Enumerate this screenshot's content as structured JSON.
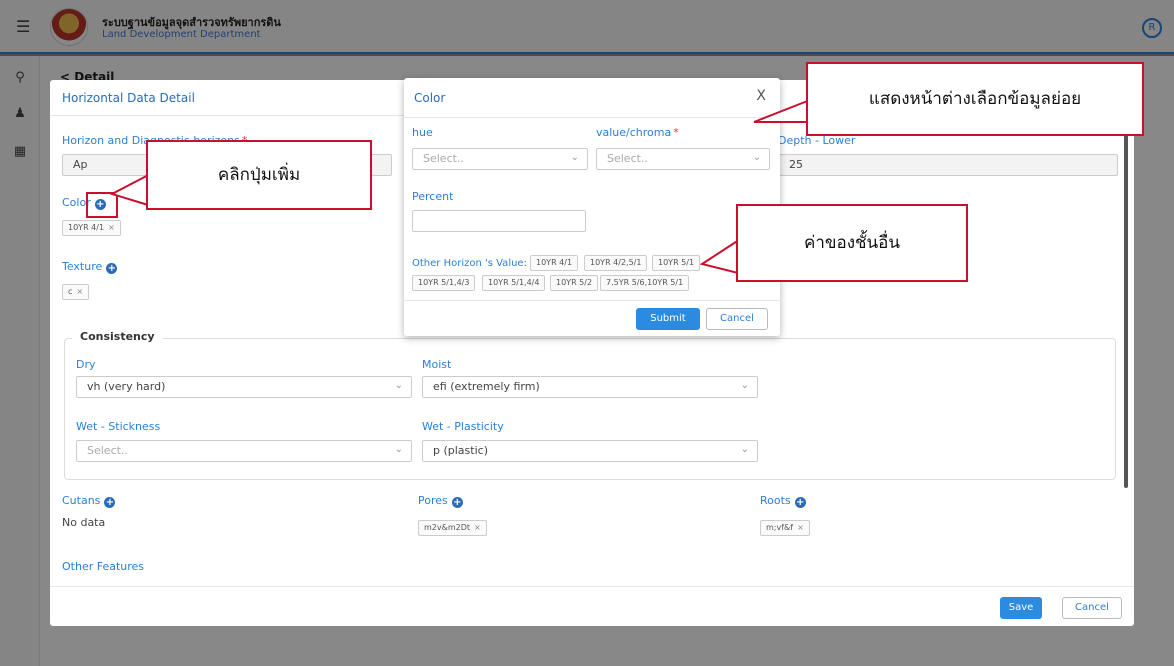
{
  "app": {
    "title": "ระบบฐานข้อมูลจุดสำรวจทรัพยากรดิน",
    "subtitle": "Land Development Department",
    "breadcrumb": "< Detail"
  },
  "detail": {
    "title": "Horizontal Data Detail",
    "horizon_label": "Horizon and Diagnostic horizons",
    "horizon_value": "Ap",
    "depth_lower_label": "Depth - Lower",
    "depth_lower_value": "25",
    "color_label": "Color",
    "color_tag": "10YR 4/1",
    "texture_label": "Texture",
    "texture_tag": "c",
    "consistency": {
      "legend": "Consistency",
      "dry_label": "Dry",
      "dry_value": "vh (very hard)",
      "moist_label": "Moist",
      "moist_value": "efi (extremely firm)",
      "wet_stick_label": "Wet - Stickness",
      "wet_stick_placeholder": "Select..",
      "wet_plast_label": "Wet - Plasticity",
      "wet_plast_value": "p (plastic)"
    },
    "cutans_label": "Cutans",
    "cutans_value": "No data",
    "pores_label": "Pores",
    "pores_tag": "m2v&m2Dt",
    "roots_label": "Roots",
    "roots_tag": "m;vf&f",
    "other_features_label": "Other Features",
    "save_label": "Save",
    "cancel_label": "Cancel",
    "tag_remove": "×"
  },
  "color_modal": {
    "title": "Color",
    "close": "X",
    "hue_label": "hue",
    "hue_placeholder": "Select..",
    "vc_label": "value/chroma",
    "vc_placeholder": "Select..",
    "percent_label": "Percent",
    "percent_value": "",
    "other_label": "Other Horizon 's Value:",
    "other_values": [
      "10YR 4/1",
      "10YR 4/2,5/1",
      "10YR 5/1",
      "10YR 5/1,4/3",
      "10YR 5/1,4/4",
      "10YR 5/2",
      "7.5YR 5/6,10YR 5/1"
    ],
    "submit_label": "Submit",
    "cancel_label": "Cancel"
  },
  "callouts": {
    "click_add": "คลิกปุ่มเพิ่ม",
    "show_window": "แสดงหน้าต่างเลือกข้อมูลย่อย",
    "other_values": "ค่าของชั้นอื่น"
  },
  "colors": {
    "primary": "#2b8be0",
    "label_blue": "#2b7fd6",
    "callout_red": "#c8102e"
  }
}
